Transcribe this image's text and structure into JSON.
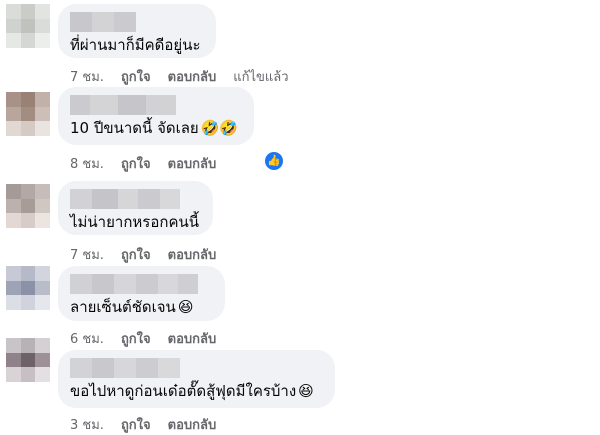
{
  "colors": {
    "bubble_bg": "#f0f2f5",
    "text": "#050505",
    "meta": "#65676b",
    "like_blue": "#1877f2"
  },
  "comments": [
    {
      "text": "ที่ผ่านมาก็มีคดีอยู่นะ",
      "emoji": "",
      "time": "7 ชม.",
      "like": "ถูกใจ",
      "reply": "ตอบกลับ",
      "edited": "แก้ไขแล้ว",
      "has_reaction": false
    },
    {
      "text": "10 ปีขนาดนี้ จัดเลย",
      "emoji": "🤣🤣",
      "time": "8 ชม.",
      "like": "ถูกใจ",
      "reply": "ตอบกลับ",
      "has_reaction": true
    },
    {
      "text": "ไม่น่ายากหรอกคนนี้",
      "emoji": "",
      "time": "7 ชม.",
      "like": "ถูกใจ",
      "reply": "ตอบกลับ",
      "has_reaction": false
    },
    {
      "text": "ลายเซ็นต์ชัดเจน",
      "emoji": "😆",
      "time": "6 ชม.",
      "like": "ถูกใจ",
      "reply": "ตอบกลับ",
      "has_reaction": false
    },
    {
      "text": "ขอไปหาดูก่อนเด๋อตั๊ดสู้ฟุดมีใครบ้าง",
      "emoji": "😆",
      "time": "3 ชม.",
      "like": "ถูกใจ",
      "reply": "ตอบกลับ",
      "has_reaction": false
    }
  ],
  "icons": {
    "reaction": "like-thumb-icon"
  }
}
